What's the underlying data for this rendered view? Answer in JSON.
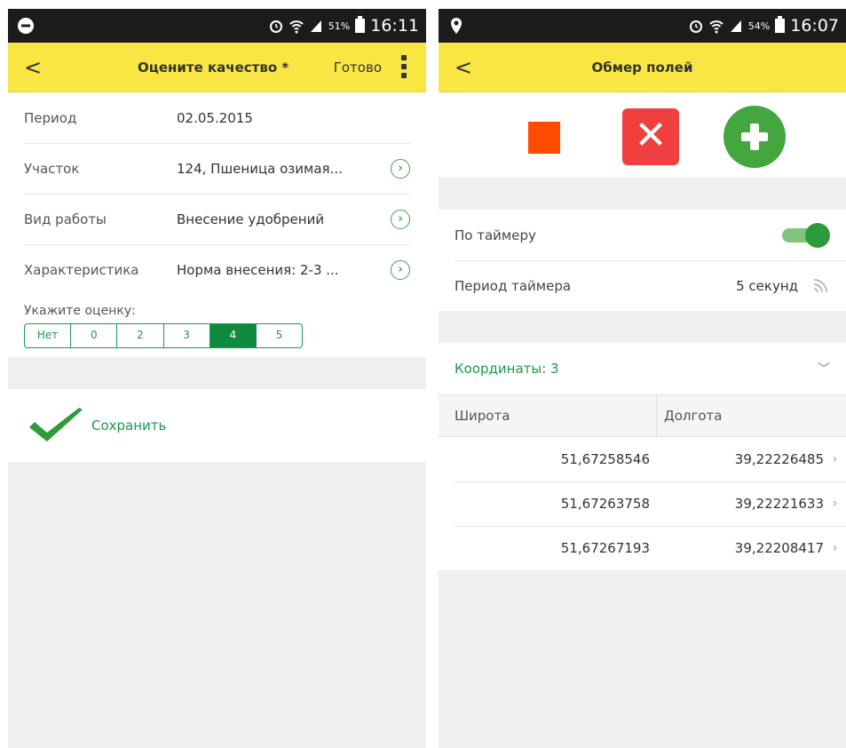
{
  "left": {
    "statusbar": {
      "battery": "51%",
      "time": "16:11"
    },
    "appbar": {
      "back": "<",
      "title": "Оцените качество *",
      "done": "Готово"
    },
    "fields": [
      {
        "label": "Период",
        "value": "02.05.2015"
      },
      {
        "label": "Участок",
        "value": "124, Пшеница озимая..."
      },
      {
        "label": "Вид работы",
        "value": "Внесение удобрений"
      },
      {
        "label": "Характеристика",
        "value": "Норма внесения: 2-3 ..."
      }
    ],
    "rating": {
      "caption": "Укажите оценку:",
      "options": [
        "Нет",
        "0",
        "2",
        "3",
        "4",
        "5"
      ],
      "selected": "4"
    },
    "save_label": "Сохранить"
  },
  "right": {
    "statusbar": {
      "battery": "54%",
      "time": "16:07"
    },
    "appbar": {
      "back": "<",
      "title": "Обмер полей"
    },
    "timer": {
      "by_timer_label": "По таймеру",
      "by_timer_on": true,
      "period_label": "Период таймера",
      "period_value": "5 секунд"
    },
    "coords": {
      "header": "Координаты: 3",
      "columns": [
        "Широта",
        "Долгота"
      ],
      "rows": [
        [
          "51,67258546",
          "39,22226485"
        ],
        [
          "51,67263758",
          "39,22221633"
        ],
        [
          "51,67267193",
          "39,22208417"
        ]
      ]
    },
    "colors": {
      "accent": "#f9e643",
      "green": "#1a9a4c",
      "red": "#ef3f3f",
      "orange": "#ff4b00"
    }
  }
}
